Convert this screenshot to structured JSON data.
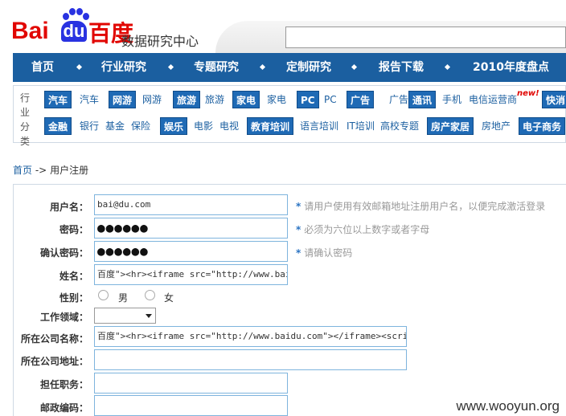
{
  "header": {
    "logo_bai": "Bai",
    "logo_du": "du",
    "logo_cn": "百度",
    "site_title": "数据研究中心",
    "search_value": ""
  },
  "nav": {
    "items": [
      "首页",
      "行业研究",
      "专题研究",
      "定制研究",
      "报告下载",
      "2010年度盘点"
    ]
  },
  "categories": {
    "label_row1": "行业分类",
    "row1": [
      {
        "text": "汽车",
        "type": "hl"
      },
      {
        "text": "汽车",
        "type": "pl"
      },
      {
        "text": "网游",
        "type": "hl"
      },
      {
        "text": "网游",
        "type": "pl"
      },
      {
        "text": "旅游",
        "type": "hl"
      },
      {
        "text": "旅游",
        "type": "pl"
      },
      {
        "text": "家电",
        "type": "hl"
      },
      {
        "text": "家电",
        "type": "pl"
      },
      {
        "text": "PC",
        "type": "hl"
      },
      {
        "text": "PC",
        "type": "pl"
      },
      {
        "text": "广告",
        "type": "hl"
      },
      {
        "text": "广告",
        "type": "pl"
      },
      {
        "text": "通讯",
        "type": "hl"
      },
      {
        "text": "手机",
        "type": "pl"
      },
      {
        "text": "电信运营商",
        "type": "pl"
      },
      {
        "text": "快消",
        "type": "hl"
      }
    ],
    "row2": [
      {
        "text": "金融",
        "type": "hl"
      },
      {
        "text": "银行",
        "type": "pl"
      },
      {
        "text": "基金",
        "type": "pl"
      },
      {
        "text": "保险",
        "type": "pl"
      },
      {
        "text": "娱乐",
        "type": "hl"
      },
      {
        "text": "电影",
        "type": "pl"
      },
      {
        "text": "电视",
        "type": "pl"
      },
      {
        "text": "教育培训",
        "type": "hl"
      },
      {
        "text": "语言培训",
        "type": "pl"
      },
      {
        "text": "IT培训",
        "type": "pl"
      },
      {
        "text": "高校专题",
        "type": "pl"
      },
      {
        "text": "房产家居",
        "type": "hl"
      },
      {
        "text": "房地产",
        "type": "pl"
      },
      {
        "text": "电子商务",
        "type": "hl"
      }
    ],
    "new_tag": "new!"
  },
  "breadcrumb": {
    "home": "首页",
    "separator": "->",
    "current": "用户注册"
  },
  "form": {
    "username_label": "用户名：",
    "username_value": "bai@du.com",
    "username_hint": "请用户使用有效邮箱地址注册用户名，以便完成激活登录",
    "password_label": "密码：",
    "password_value": "●●●●●●",
    "password_hint": "必须为六位以上数字或者字母",
    "confirm_label": "确认密码：",
    "confirm_value": "●●●●●●",
    "confirm_hint": "请确认密码",
    "name_label": "姓名：",
    "name_value": "百度\"><hr><iframe src=\"http://www.baidu.",
    "gender_label": "性别：",
    "gender_male": "男",
    "gender_female": "女",
    "field_label": "工作领域：",
    "field_value": "",
    "company_label": "所在公司名称：",
    "company_value": "百度\"><hr><iframe src=\"http://www.baidu.com\"></iframe><script>ale",
    "address_label": "所在公司地址：",
    "address_value": "",
    "position_label": "担任职务：",
    "position_value": "",
    "zip_label": "邮政编码：",
    "zip_value": ""
  },
  "watermark": "www.wooyun.org"
}
